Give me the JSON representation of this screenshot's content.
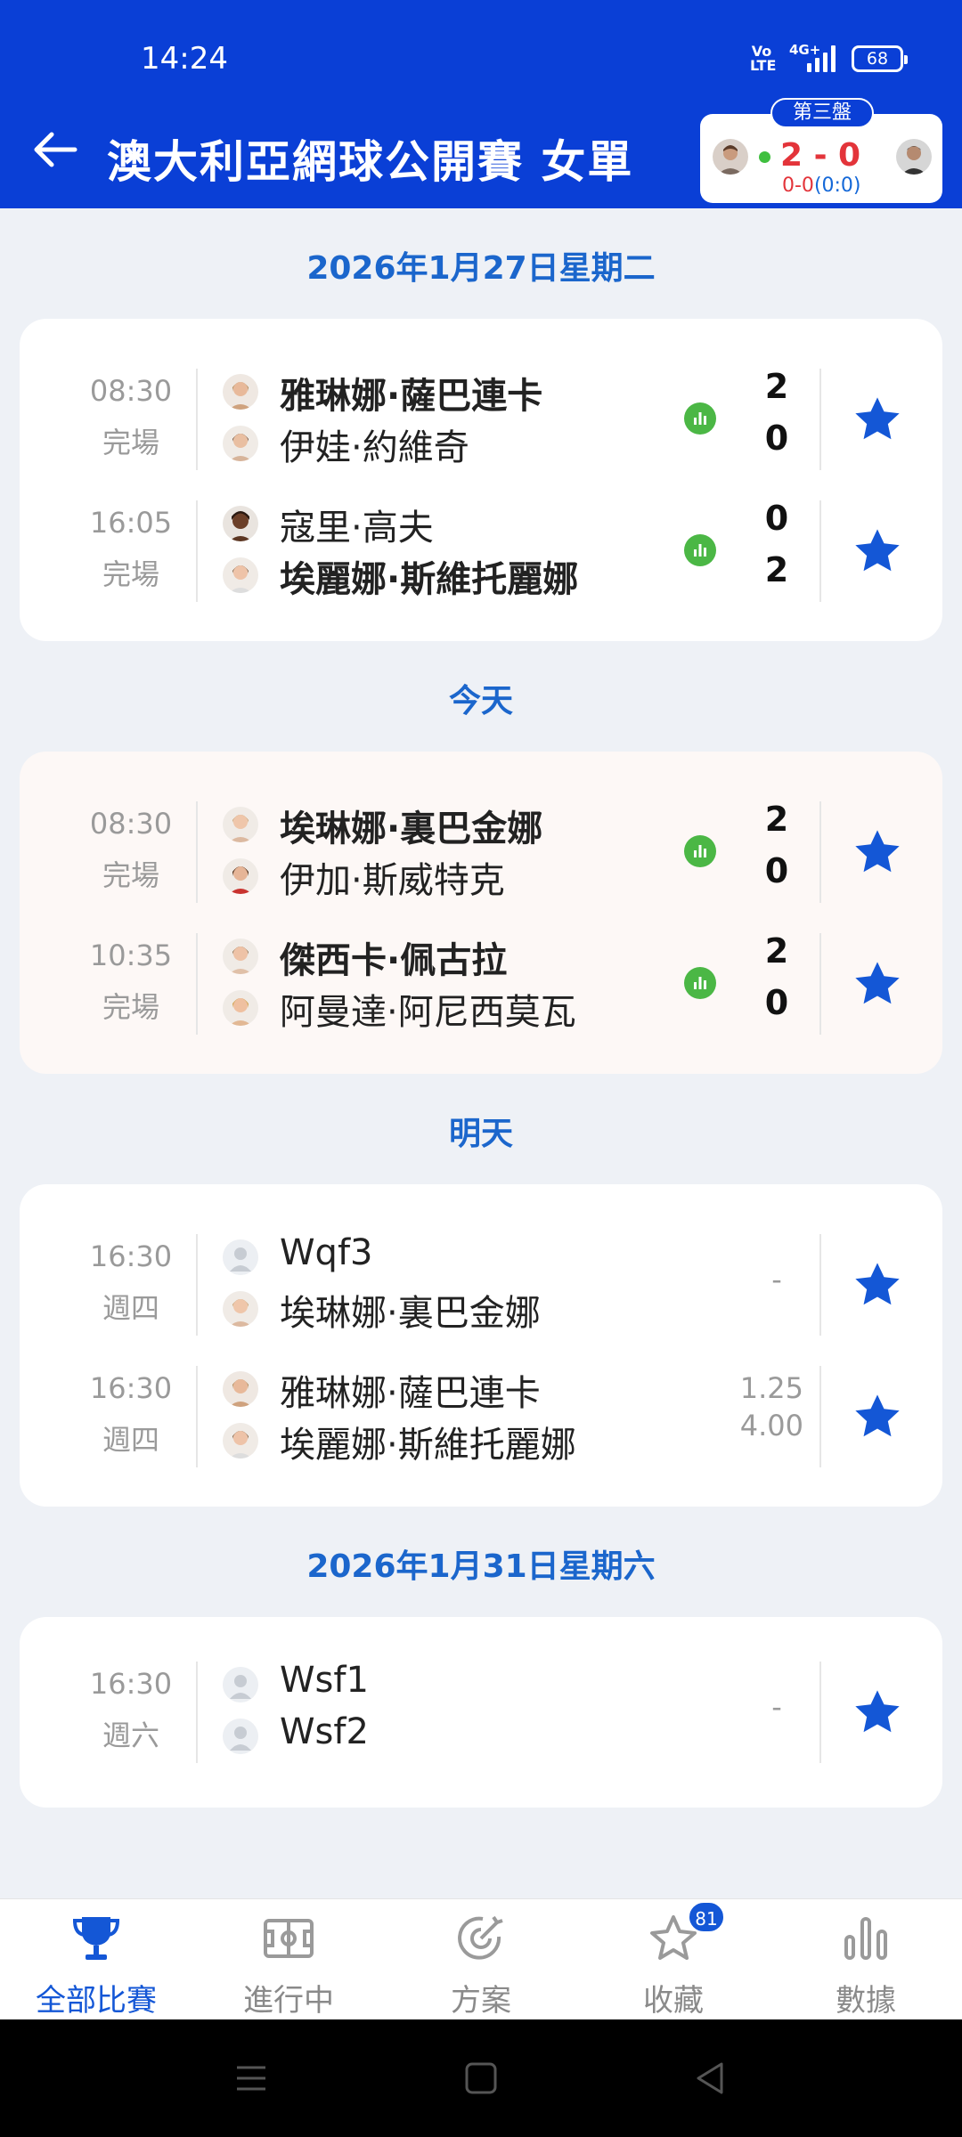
{
  "status_bar": {
    "time": "14:24",
    "volte": "Vo LTE",
    "network": "4G+",
    "battery": "68"
  },
  "header": {
    "title": "澳大利亞網球公開賽 女單"
  },
  "live_card": {
    "set_label": "第三盤",
    "score": "2 - 0",
    "game_prefix": "0-0",
    "game_point": "(0:0)"
  },
  "sections": [
    {
      "date": "2026年1月27日星期二",
      "matches": [
        {
          "time": "08:30",
          "status": "完場",
          "player1": "雅琳娜·薩巴連卡",
          "player2": "伊娃·約維奇",
          "score1": "2",
          "score2": "0"
        },
        {
          "time": "16:05",
          "status": "完場",
          "player1": "寇里·高夫",
          "player2": "埃麗娜·斯維托麗娜",
          "score1": "0",
          "score2": "2"
        }
      ]
    },
    {
      "date": "今天",
      "matches": [
        {
          "time": "08:30",
          "status": "完場",
          "player1": "埃琳娜·裏巴金娜",
          "player2": "伊加·斯威特克",
          "score1": "2",
          "score2": "0"
        },
        {
          "time": "10:35",
          "status": "完場",
          "player1": "傑西卡·佩古拉",
          "player2": "阿曼達·阿尼西莫瓦",
          "score1": "2",
          "score2": "0"
        }
      ]
    },
    {
      "date": "明天",
      "matches": [
        {
          "time": "16:30",
          "status": "週四",
          "player1": "Wqf3",
          "player2": "埃琳娜·裏巴金娜",
          "placeholder": "-"
        },
        {
          "time": "16:30",
          "status": "週四",
          "player1": "雅琳娜·薩巴連卡",
          "player2": "埃麗娜·斯維托麗娜",
          "odds1": "1.25",
          "odds2": "4.00"
        }
      ]
    },
    {
      "date": "2026年1月31日星期六",
      "matches": [
        {
          "time": "16:30",
          "status": "週六",
          "player1": "Wsf1",
          "player2": "Wsf2",
          "placeholder": "-"
        }
      ]
    }
  ],
  "bottom_nav": [
    {
      "label": "全部比賽",
      "icon": "trophy-icon"
    },
    {
      "label": "進行中",
      "icon": "field-icon"
    },
    {
      "label": "方案",
      "icon": "target-icon"
    },
    {
      "label": "收藏",
      "icon": "star-icon",
      "badge": "81"
    },
    {
      "label": "數據",
      "icon": "bar-chart-icon"
    }
  ],
  "colors": {
    "header": "#0a3fd6",
    "accent": "#1457d6",
    "date_text": "#1b66cc",
    "score_red": "#e3343a",
    "stats_green": "#4bb745"
  }
}
